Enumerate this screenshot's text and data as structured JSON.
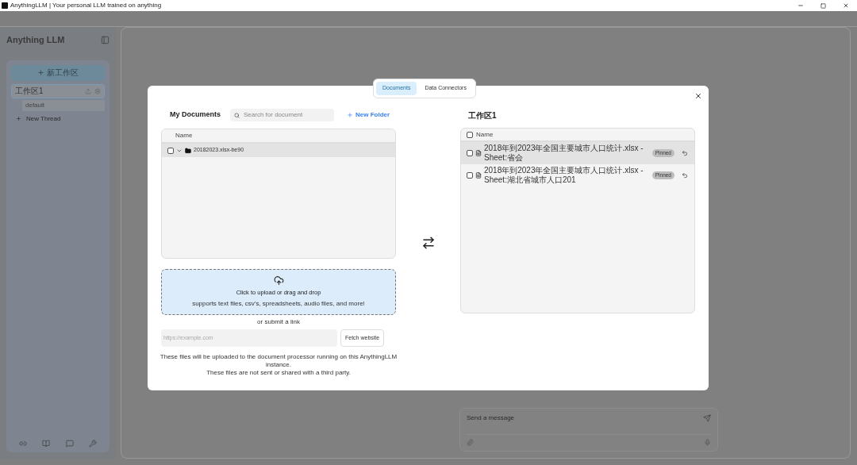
{
  "window": {
    "title": "AnythingLLM | Your personal LLM trained on anything"
  },
  "sidebar": {
    "logo": "Anything LLM",
    "new_workspace_button": "新工作区",
    "workspaces": [
      {
        "name": "工作区1",
        "selected": true,
        "threads": [
          {
            "name": "default",
            "selected": true
          }
        ]
      }
    ],
    "new_thread": "New Thread"
  },
  "chat": {
    "input": {
      "placeholder": "Send a message"
    }
  },
  "modal": {
    "tabs": [
      {
        "label": "Documents",
        "selected": true
      },
      {
        "label": "Data Connectors",
        "selected": false
      }
    ],
    "my_documents": {
      "title": "My Documents",
      "search": {
        "placeholder": "Search for document"
      },
      "new_folder": "New Folder",
      "table": {
        "columns": [
          "Name"
        ],
        "rows": [
          {
            "name": "20182023.xlsx-be90",
            "checked": false,
            "selected": true
          }
        ]
      }
    },
    "upload": {
      "title": "Click to upload or drag and drop",
      "subtitle": "supports text files, csv's, spreadsheets, audio files, and more!"
    },
    "link": {
      "label": "or submit a link",
      "placeholder": "https://example.com",
      "button": "Fetch website"
    },
    "notice": [
      "These files will be uploaded to the document processor running on this AnythingLLM instance.",
      "These files are not sent or shared with a third party."
    ],
    "workspace": {
      "title": "工作区1",
      "table": {
        "columns": [
          "Name"
        ],
        "all_checked": false,
        "rows": [
          {
            "name": "2018年到2023年全国主要城市人口统计.xlsx - Sheet:省会",
            "checked": false,
            "selected": true,
            "badge": "Pinned"
          },
          {
            "name": "2018年到2023年全国主要城市人口统计.xlsx - Sheet:湖北省城市人口201",
            "checked": false,
            "selected": false,
            "badge": "Pinned"
          }
        ]
      }
    }
  }
}
